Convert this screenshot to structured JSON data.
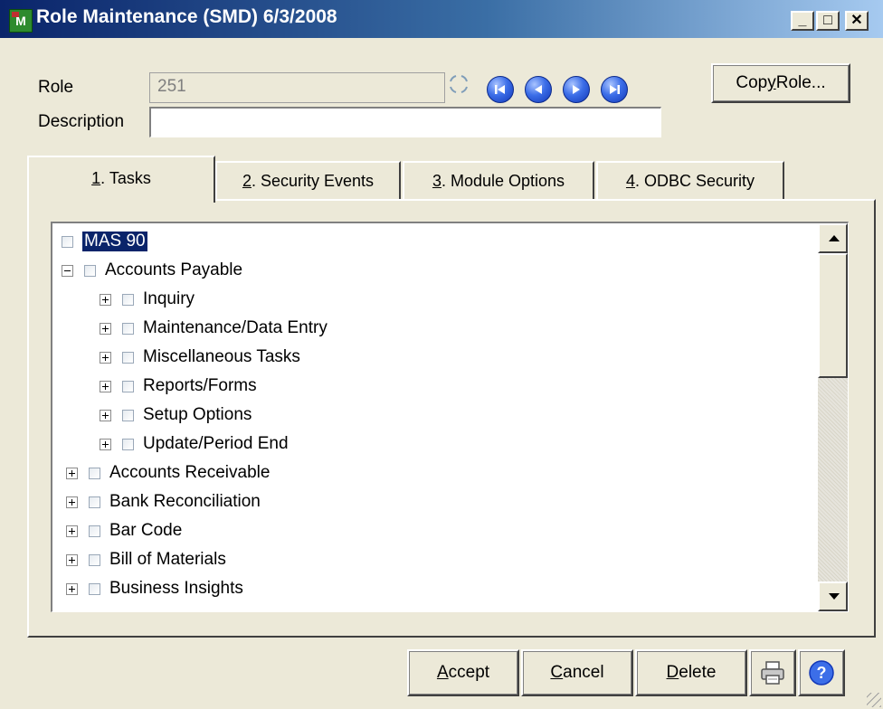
{
  "window": {
    "title": "Role Maintenance (SMD) 6/3/2008",
    "controls": {
      "minimize": "_",
      "maximize": "□",
      "close": "✕"
    }
  },
  "form": {
    "role_label": "Role",
    "role_value": "251",
    "description_label": "Description",
    "description_value": "",
    "copy_role_button": {
      "prefix": "Cop",
      "accel": "y",
      "suffix": " Role..."
    }
  },
  "nav_icons": [
    "first-record-icon",
    "previous-record-icon",
    "next-record-icon",
    "last-record-icon"
  ],
  "tabs": [
    {
      "accel": "1",
      "rest": ". Tasks",
      "active": true
    },
    {
      "accel": "2",
      "rest": ". Security Events",
      "active": false
    },
    {
      "accel": "3",
      "rest": ". Module Options",
      "active": false
    },
    {
      "accel": "4",
      "rest": ". ODBC Security",
      "active": false
    }
  ],
  "tree": {
    "root": "MAS 90",
    "items": [
      {
        "label": "Accounts Payable",
        "expanded": true,
        "children": [
          "Inquiry",
          "Maintenance/Data Entry",
          "Miscellaneous Tasks",
          "Reports/Forms",
          "Setup Options",
          "Update/Period End"
        ]
      },
      {
        "label": "Accounts Receivable"
      },
      {
        "label": "Bank Reconciliation"
      },
      {
        "label": "Bar Code"
      },
      {
        "label": "Bill of Materials"
      },
      {
        "label": "Business Insights"
      }
    ]
  },
  "bottom_buttons": {
    "accept": {
      "accel": "A",
      "rest": "ccept"
    },
    "cancel": {
      "accel": "C",
      "rest": "ancel"
    },
    "delete": {
      "accel": "D",
      "rest": "elete"
    },
    "print_icon": "printer-icon",
    "help_icon": "help-icon"
  },
  "colors": {
    "titlebar_start": "#0a246a",
    "titlebar_end": "#a6caf0",
    "selection": "#0a246a",
    "nav_blue": "#3c6ee8",
    "window_bg": "#ece9d8"
  }
}
